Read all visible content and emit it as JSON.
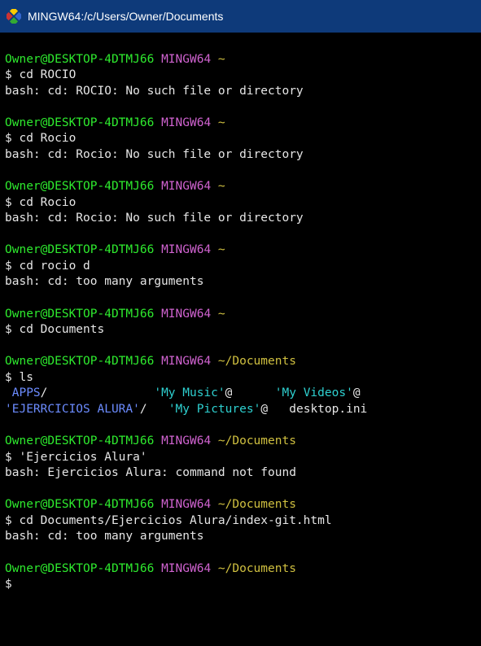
{
  "titlebar": {
    "title": "MINGW64:/c/Users/Owner/Documents"
  },
  "prompt": {
    "user": "Owner@DESKTOP-4DTMJ66",
    "env": "MINGW64",
    "home_path": "~",
    "docs_path": "~/Documents",
    "symbol": "$"
  },
  "blocks": [
    {
      "path_key": "home_path",
      "command": "cd ROCIO",
      "output": [
        "bash: cd: ROCIO: No such file or directory"
      ]
    },
    {
      "path_key": "home_path",
      "command": "cd Rocio",
      "output": [
        "bash: cd: Rocio: No such file or directory"
      ]
    },
    {
      "path_key": "home_path",
      "command": "cd Rocio",
      "output": [
        "bash: cd: Rocio: No such file or directory"
      ]
    },
    {
      "path_key": "home_path",
      "command": "cd rocio d",
      "output": [
        "bash: cd: too many arguments"
      ]
    },
    {
      "path_key": "home_path",
      "command": "cd Documents",
      "output": []
    }
  ],
  "ls_block": {
    "path_key": "docs_path",
    "command": "ls",
    "entries": {
      "apps": " APPS",
      "apps_slash": "/",
      "ejerc": "'EJERRCICIOS ALURA'",
      "ejerc_slash": "/",
      "music": "'My Music'",
      "pictures": "'My Pictures'",
      "videos": "'My Videos'",
      "at": "@",
      "desktop_ini": "desktop.ini"
    },
    "pad1": "               ",
    "pad2": "      ",
    "pad3": "   ",
    "pad4": "   "
  },
  "blocks2": [
    {
      "path_key": "docs_path",
      "command": "'Ejercicios Alura'",
      "output": [
        "bash: Ejercicios Alura: command not found"
      ]
    },
    {
      "path_key": "docs_path",
      "command": "cd Documents/Ejercicios Alura/index-git.html",
      "output": [
        "bash: cd: too many arguments"
      ]
    },
    {
      "path_key": "docs_path",
      "command": "",
      "output": []
    }
  ]
}
